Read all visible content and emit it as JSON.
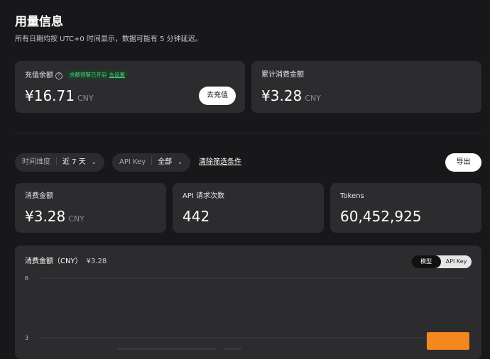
{
  "header": {
    "title": "用量信息",
    "subtitle": "所有日期均按 UTC+0 时间显示，数据可能有 5 分钟延迟。"
  },
  "balance_card": {
    "label": "充值余额",
    "help_icon": "question-circle-icon",
    "alert_text": "余额预警已开启",
    "alert_link": "去设置",
    "value": "¥16.71",
    "unit": "CNY",
    "button": "去充值"
  },
  "total_spend_card": {
    "label": "累计消费金额",
    "value": "¥3.28",
    "unit": "CNY"
  },
  "filters": {
    "time": {
      "label": "时间维度",
      "value": "近 7 天"
    },
    "api_key": {
      "label": "API Key",
      "value": "全部"
    },
    "clear": "清除筛选条件",
    "export": "导出"
  },
  "stats": [
    {
      "label": "消费金额",
      "value": "¥3.28",
      "unit": "CNY"
    },
    {
      "label": "API 请求次数",
      "value": "442",
      "unit": ""
    },
    {
      "label": "Tokens",
      "value": "60,452,925",
      "unit": ""
    }
  ],
  "chart": {
    "title": "消费金额（CNY）",
    "total": "¥3.28",
    "toggle": [
      {
        "label": "模型",
        "active": true
      },
      {
        "label": "API Key",
        "active": false
      }
    ]
  },
  "chart_data": {
    "type": "bar",
    "title": "消费金额（CNY）",
    "yticks": [
      "6",
      "3"
    ],
    "ylim": [
      0,
      6
    ],
    "categories": [
      "",
      "",
      "",
      "",
      "",
      "",
      ""
    ],
    "values": [
      0,
      0,
      0,
      0,
      0,
      0,
      3.28
    ],
    "colors": {
      "bar": "#f5871f"
    },
    "grid": true,
    "legend": "none"
  }
}
